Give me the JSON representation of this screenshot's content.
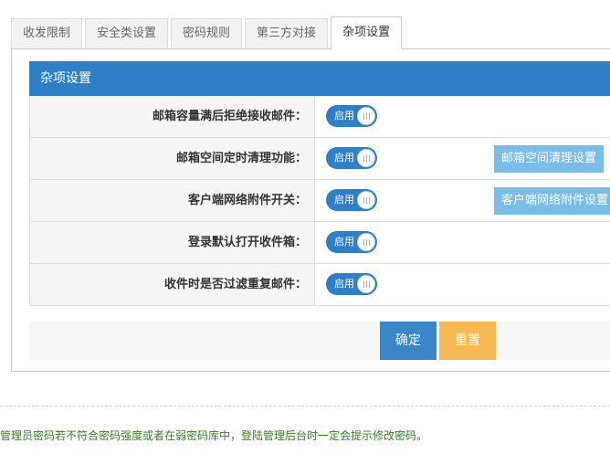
{
  "tabs": [
    {
      "label": "收发限制",
      "active": false
    },
    {
      "label": "安全类设置",
      "active": false
    },
    {
      "label": "密码规则",
      "active": false
    },
    {
      "label": "第三方对接",
      "active": false
    },
    {
      "label": "杂项设置",
      "active": true
    }
  ],
  "section": {
    "title": "杂项设置"
  },
  "settings": [
    {
      "label": "邮箱容量满后拒绝接收邮件：",
      "toggle": "启用",
      "enabled": true
    },
    {
      "label": "邮箱空间定时清理功能：",
      "toggle": "启用",
      "enabled": true,
      "button": "邮箱空间清理设置"
    },
    {
      "label": "客户端网络附件开关：",
      "toggle": "启用",
      "enabled": true,
      "button": "客户端网络附件设置"
    },
    {
      "label": "登录默认打开收件箱：",
      "toggle": "启用",
      "enabled": true
    },
    {
      "label": "收件时是否过滤重复邮件：",
      "toggle": "启用",
      "enabled": true
    }
  ],
  "actions": {
    "confirm": "确定",
    "reset": "重置"
  },
  "notice": "管理员密码若不符合密码强度或者在弱密码库中，登陆管理后台时一定会提示修改密码。",
  "colors": {
    "accent": "#2f7fc7",
    "side_button": "#7cbde8",
    "reset_button": "#f6b954",
    "notice_text": "#3a7a2a"
  }
}
